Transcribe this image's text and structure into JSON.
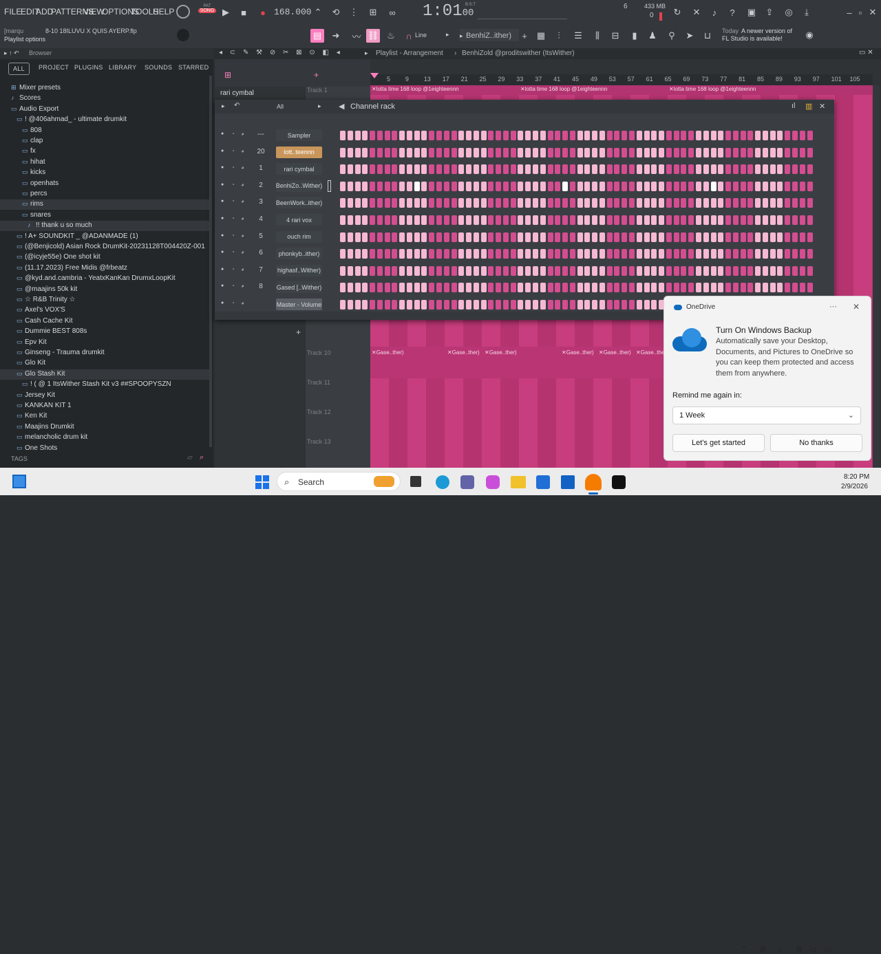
{
  "menu": [
    "FILE",
    "EDIT",
    "ADD",
    "PATTERNS",
    "VIEW",
    "OPTIONS",
    "TOOLS",
    "HELP"
  ],
  "transport": {
    "pat_label": "PAT",
    "song_label": "SONG",
    "tempo": "168.000",
    "time": "1:01",
    "time_sub": "00",
    "time_unit": "B:S:T",
    "cpu_value": "6",
    "memory": "433 MB",
    "voices": "0"
  },
  "project": {
    "user": "[marqu",
    "file": "8-10 18ILUVU X QUIS AYERP.flp",
    "hint": "Playlist options"
  },
  "toolbar": {
    "snap": "Line",
    "pattern": "BenhiZ..ither)",
    "news_date": "Today",
    "news_text_1": "A newer version of",
    "news_text_2": "FL Studio is available!"
  },
  "browser": {
    "title": "Browser",
    "tabs": [
      "ALL",
      "PROJECT",
      "PLUGINS",
      "LIBRARY",
      "SOUNDS",
      "STARRED"
    ],
    "items": [
      {
        "label": "Mixer presets",
        "icon": "mixer-icon",
        "indent": 0
      },
      {
        "label": "Scores",
        "icon": "note-icon",
        "indent": 0
      },
      {
        "label": "Audio Export",
        "icon": "folder-icon",
        "indent": 0
      },
      {
        "label": "! @406ahmad_ - ultimate drumkit",
        "icon": "folder-icon",
        "indent": 1
      },
      {
        "label": "808",
        "icon": "folder-icon",
        "indent": 2
      },
      {
        "label": "clap",
        "icon": "folder-icon",
        "indent": 2
      },
      {
        "label": "fx",
        "icon": "folder-icon",
        "indent": 2
      },
      {
        "label": "hihat",
        "icon": "folder-icon",
        "indent": 2
      },
      {
        "label": "kicks",
        "icon": "folder-icon",
        "indent": 2
      },
      {
        "label": "openhats",
        "icon": "folder-icon",
        "indent": 2
      },
      {
        "label": "percs",
        "icon": "folder-icon",
        "indent": 2
      },
      {
        "label": "rims",
        "icon": "folder-icon",
        "indent": 2
      },
      {
        "label": "snares",
        "icon": "folder-icon",
        "indent": 2
      },
      {
        "label": "!! thank u so much",
        "icon": "file-icon",
        "indent": 3
      },
      {
        "label": "! A+ SOUNDKIT _ @ADANMADE (1)",
        "icon": "folder-icon",
        "indent": 1
      },
      {
        "label": "(@Benjicold) Asian Rock DrumKit-20231128T004420Z-001",
        "icon": "folder-icon",
        "indent": 1
      },
      {
        "label": "(@icyje55e) One shot kit",
        "icon": "folder-icon",
        "indent": 1
      },
      {
        "label": "(11.17.2023) Free Midis @frbeatz",
        "icon": "folder-icon",
        "indent": 1
      },
      {
        "label": "@kyd.and.cambria - YeatxKanKan DrumxLoopKit",
        "icon": "folder-icon",
        "indent": 1
      },
      {
        "label": "@maajins 50k kit",
        "icon": "folder-icon",
        "indent": 1
      },
      {
        "label": "☆ R&B Trinity ☆",
        "icon": "folder-icon",
        "indent": 1
      },
      {
        "label": "Axel's VOX'S",
        "icon": "folder-icon",
        "indent": 1
      },
      {
        "label": "Cash Cache Kit",
        "icon": "folder-icon",
        "indent": 1
      },
      {
        "label": "Dummie BEST 808s",
        "icon": "folder-icon",
        "indent": 1
      },
      {
        "label": "Epv Kit",
        "icon": "folder-icon",
        "indent": 1
      },
      {
        "label": "Ginseng - Trauma drumkit",
        "icon": "folder-icon",
        "indent": 1
      },
      {
        "label": "Glo Kit",
        "icon": "folder-icon",
        "indent": 1
      },
      {
        "label": "Glo Stash Kit",
        "icon": "folder-icon",
        "indent": 1
      },
      {
        "label": "! ( @ 1 ItsWither Stash Kit v3 ##SPOOPYSZN",
        "icon": "folder-icon",
        "indent": 2
      },
      {
        "label": "Jersey Kit",
        "icon": "folder-icon",
        "indent": 1
      },
      {
        "label": "KANKAN KIT 1",
        "icon": "folder-icon",
        "indent": 1
      },
      {
        "label": "Ken Kit",
        "icon": "folder-icon",
        "indent": 1
      },
      {
        "label": "Maajins Drumkit",
        "icon": "folder-icon",
        "indent": 1
      },
      {
        "label": "melancholic drum kit",
        "icon": "folder-icon",
        "indent": 1
      },
      {
        "label": "One Shots",
        "icon": "folder-icon",
        "indent": 1
      }
    ],
    "tags_label": "TAGS"
  },
  "playlist": {
    "title": "Playlist - Arrangement",
    "breadcrumb": "BenhiZold @proditswither (ItsWither)",
    "ruler": [
      "5",
      "9",
      "13",
      "17",
      "21",
      "25",
      "29",
      "33",
      "37",
      "41",
      "45",
      "49",
      "53",
      "57",
      "61",
      "65",
      "69",
      "73",
      "77",
      "81",
      "85",
      "89",
      "93",
      "97",
      "101",
      "105"
    ],
    "tracks": [
      "Track 1",
      "Track 10",
      "Track 11",
      "Track 12",
      "Track 13"
    ],
    "top_clips": [
      "lotta time 168 loop @1eighteennn",
      "lotta time 168 loop @1eighteennn",
      "lotta time 168 loop @1eighteennn"
    ],
    "bottom_clips": [
      "Gase..ther)",
      "Gase..ther)",
      "Gase..ther)",
      "Gase..ther)",
      "Gase..ther)",
      "Gase..ther)"
    ],
    "side_label": "rari cymbal"
  },
  "channel_rack": {
    "title": "Channel rack",
    "filter": "All",
    "channels": [
      {
        "num": "---",
        "name": "Sampler",
        "highlight": false,
        "accent": false
      },
      {
        "num": "20",
        "name": "lott..teennn",
        "highlight": true,
        "accent": false
      },
      {
        "num": "1",
        "name": "rari cymbal",
        "highlight": false,
        "accent": false
      },
      {
        "num": "2",
        "name": "BenhiZo..Wither)",
        "highlight": false,
        "accent": true
      },
      {
        "num": "3",
        "name": "BeenWork..ither)",
        "highlight": false,
        "accent": false
      },
      {
        "num": "4",
        "name": "4 rari vox",
        "highlight": false,
        "accent": false
      },
      {
        "num": "5",
        "name": "ouch rim",
        "highlight": false,
        "accent": false
      },
      {
        "num": "6",
        "name": "phonkyb..ither)",
        "highlight": false,
        "accent": false
      },
      {
        "num": "7",
        "name": "highasf..Wither)",
        "highlight": false,
        "accent": false
      },
      {
        "num": "8",
        "name": "Gased [..Wither)",
        "highlight": false,
        "accent": false
      },
      {
        "num": "",
        "name": "Master - Volume",
        "highlight": false,
        "accent": false
      }
    ],
    "steps_per_row": 64,
    "active_steps_row4": [
      10,
      30,
      50
    ]
  },
  "onedrive": {
    "app": "OneDrive",
    "title": "Turn On Windows Backup",
    "body": "Automatically save your Desktop, Documents, and Pictures to OneDrive so you can keep them protected and access them from anywhere.",
    "remind_label": "Remind me again in:",
    "remind_value": "1 Week",
    "primary": "Let's get started",
    "secondary": "No thanks"
  },
  "taskbar": {
    "search": "Search",
    "time": "8:20 PM",
    "date": "2/9/2026"
  },
  "colors": {
    "pink_light": "#f6b8d3",
    "pink_dark": "#d44d90",
    "playlist_pink": "#c83d7e"
  }
}
